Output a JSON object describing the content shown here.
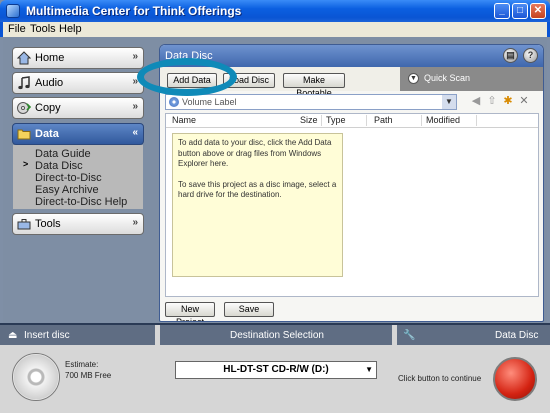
{
  "window": {
    "title": "Multimedia Center for Think Offerings",
    "min_label": "_",
    "max_label": "□",
    "close_label": "✕"
  },
  "menu": [
    "File",
    "Tools",
    "Help"
  ],
  "nav": {
    "home": "Home",
    "audio": "Audio",
    "copy": "Copy",
    "data": "Data",
    "tools": "Tools",
    "collapsed_glyph": "»",
    "expanded_glyph": "«",
    "data_items": [
      "Data Guide",
      "Data Disc",
      "Direct-to-Disc",
      "Easy Archive",
      "Direct-to-Disc Help"
    ],
    "selected_marker": ">"
  },
  "panel": {
    "title": "Data Disc",
    "toolbar": {
      "add_data": "Add Data",
      "load_disc": "Load Disc",
      "make_bootable": "Make Bootable"
    },
    "quick_scan": "Quick Scan",
    "quick_scan_glyph": "▼",
    "volume_label": "Volume Label",
    "columns": [
      "Name",
      "Size",
      "Type",
      "Path",
      "Modified"
    ],
    "hint_paragraphs": [
      "To add data to your disc, click the Add Data button above or drag files from Windows Explorer here.",
      "To save this project as a disc image, select a hard drive for the destination."
    ],
    "new_project": "New Project",
    "save": "Save"
  },
  "bottom": {
    "insert_disc": "Insert disc",
    "estimate_label": "Estimate:",
    "estimate_value": "700 MB Free",
    "destination_title": "Destination Selection",
    "drive": "HL-DT-ST CD-R/W (D:)",
    "project_type": "Data Disc",
    "continue_text": "Click button to continue"
  },
  "colors": {
    "title_bar": "#0a55d4",
    "active_nav": "#3f67ad",
    "highlight_ring": "#0f8ab8",
    "go_button": "#d42312"
  }
}
